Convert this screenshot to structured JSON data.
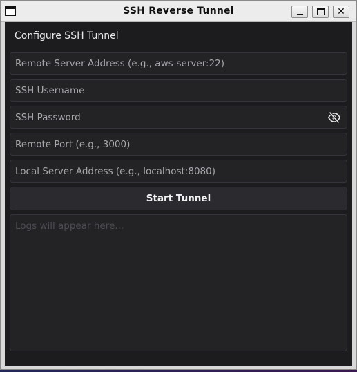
{
  "window": {
    "title": "SSH Reverse Tunnel"
  },
  "form": {
    "heading": "Configure SSH Tunnel",
    "remote_server": {
      "placeholder": "Remote Server Address (e.g., aws-server:22)",
      "value": ""
    },
    "username": {
      "placeholder": "SSH Username",
      "value": ""
    },
    "password": {
      "placeholder": "SSH Password",
      "value": "",
      "toggle_icon": "eye-slash-icon"
    },
    "remote_port": {
      "placeholder": "Remote Port (e.g., 3000)",
      "value": ""
    },
    "local_server": {
      "placeholder": "Local Server Address (e.g., localhost:8080)",
      "value": ""
    },
    "start_button": "Start Tunnel"
  },
  "logs": {
    "placeholder": "Logs will appear here...",
    "value": ""
  },
  "icons": {
    "app": "window-icon",
    "minimize": "minimize-icon",
    "maximize": "maximize-icon",
    "close": "close-icon",
    "close_glyph": "✕"
  },
  "colors": {
    "background": "#1c1c1f",
    "field": "#232326",
    "button": "#2b2b2f",
    "text": "#e8e8ea",
    "placeholder": "#a7a7ab"
  }
}
